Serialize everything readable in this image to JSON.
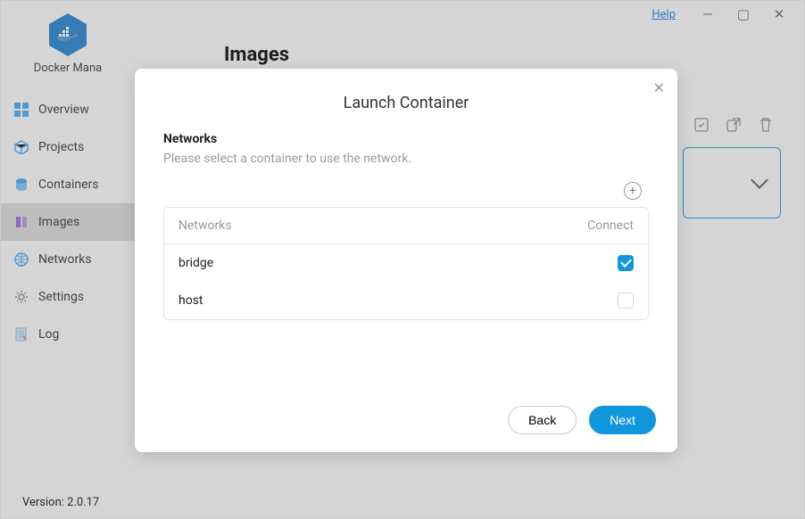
{
  "titlebar": {
    "help": "Help"
  },
  "app": {
    "name": "Docker Mana",
    "version_label": "Version: 2.0.17"
  },
  "nav": {
    "items": [
      {
        "label": "Overview"
      },
      {
        "label": "Projects"
      },
      {
        "label": "Containers"
      },
      {
        "label": "Images"
      },
      {
        "label": "Networks"
      },
      {
        "label": "Settings"
      },
      {
        "label": "Log"
      }
    ]
  },
  "page": {
    "title": "Images"
  },
  "modal": {
    "title": "Launch Container",
    "section_title": "Networks",
    "section_subtitle": "Please select a container to use the network.",
    "table": {
      "col_name": "Networks",
      "col_connect": "Connect",
      "rows": [
        {
          "name": "bridge",
          "connected": true
        },
        {
          "name": "host",
          "connected": false
        }
      ]
    },
    "back": "Back",
    "next": "Next"
  }
}
